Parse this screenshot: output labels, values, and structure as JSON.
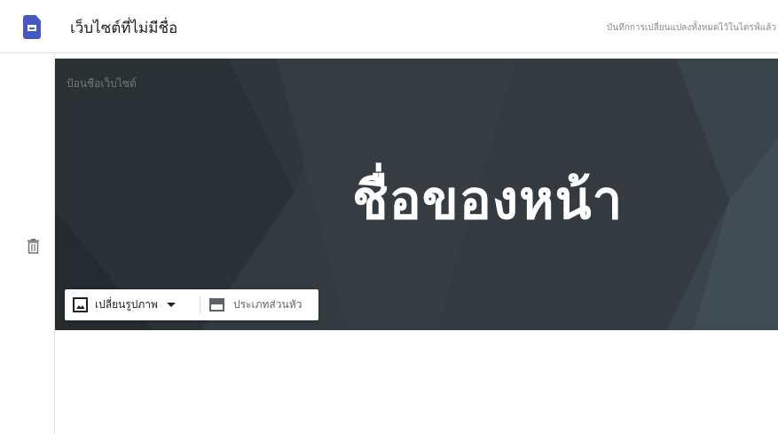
{
  "topbar": {
    "site_title": "เว็บไซต์ที่ไม่มีชื่อ",
    "save_status": "บันทึกการเปลี่ยนแปลงทั้งหมดไว้ในไดรฟ์แล้ว",
    "logo_icon": "google-sites-icon"
  },
  "left_rail": {
    "delete_icon": "trash-icon"
  },
  "header": {
    "site_name_placeholder": "ป้อนชื่อเว็บไซต์",
    "page_title": "ชื่อของหน้า",
    "background_color": "#333b41"
  },
  "toolbar": {
    "change_image_label": "เปลี่ยนรูปภาพ",
    "change_image_icon": "image-icon",
    "header_type_label": "ประเภทส่วนหัว",
    "header_type_icon": "header-layout-icon",
    "caret_icon": "chevron-down-icon"
  },
  "colors": {
    "brand": "#4658c3",
    "header_dark": "#333b41"
  }
}
